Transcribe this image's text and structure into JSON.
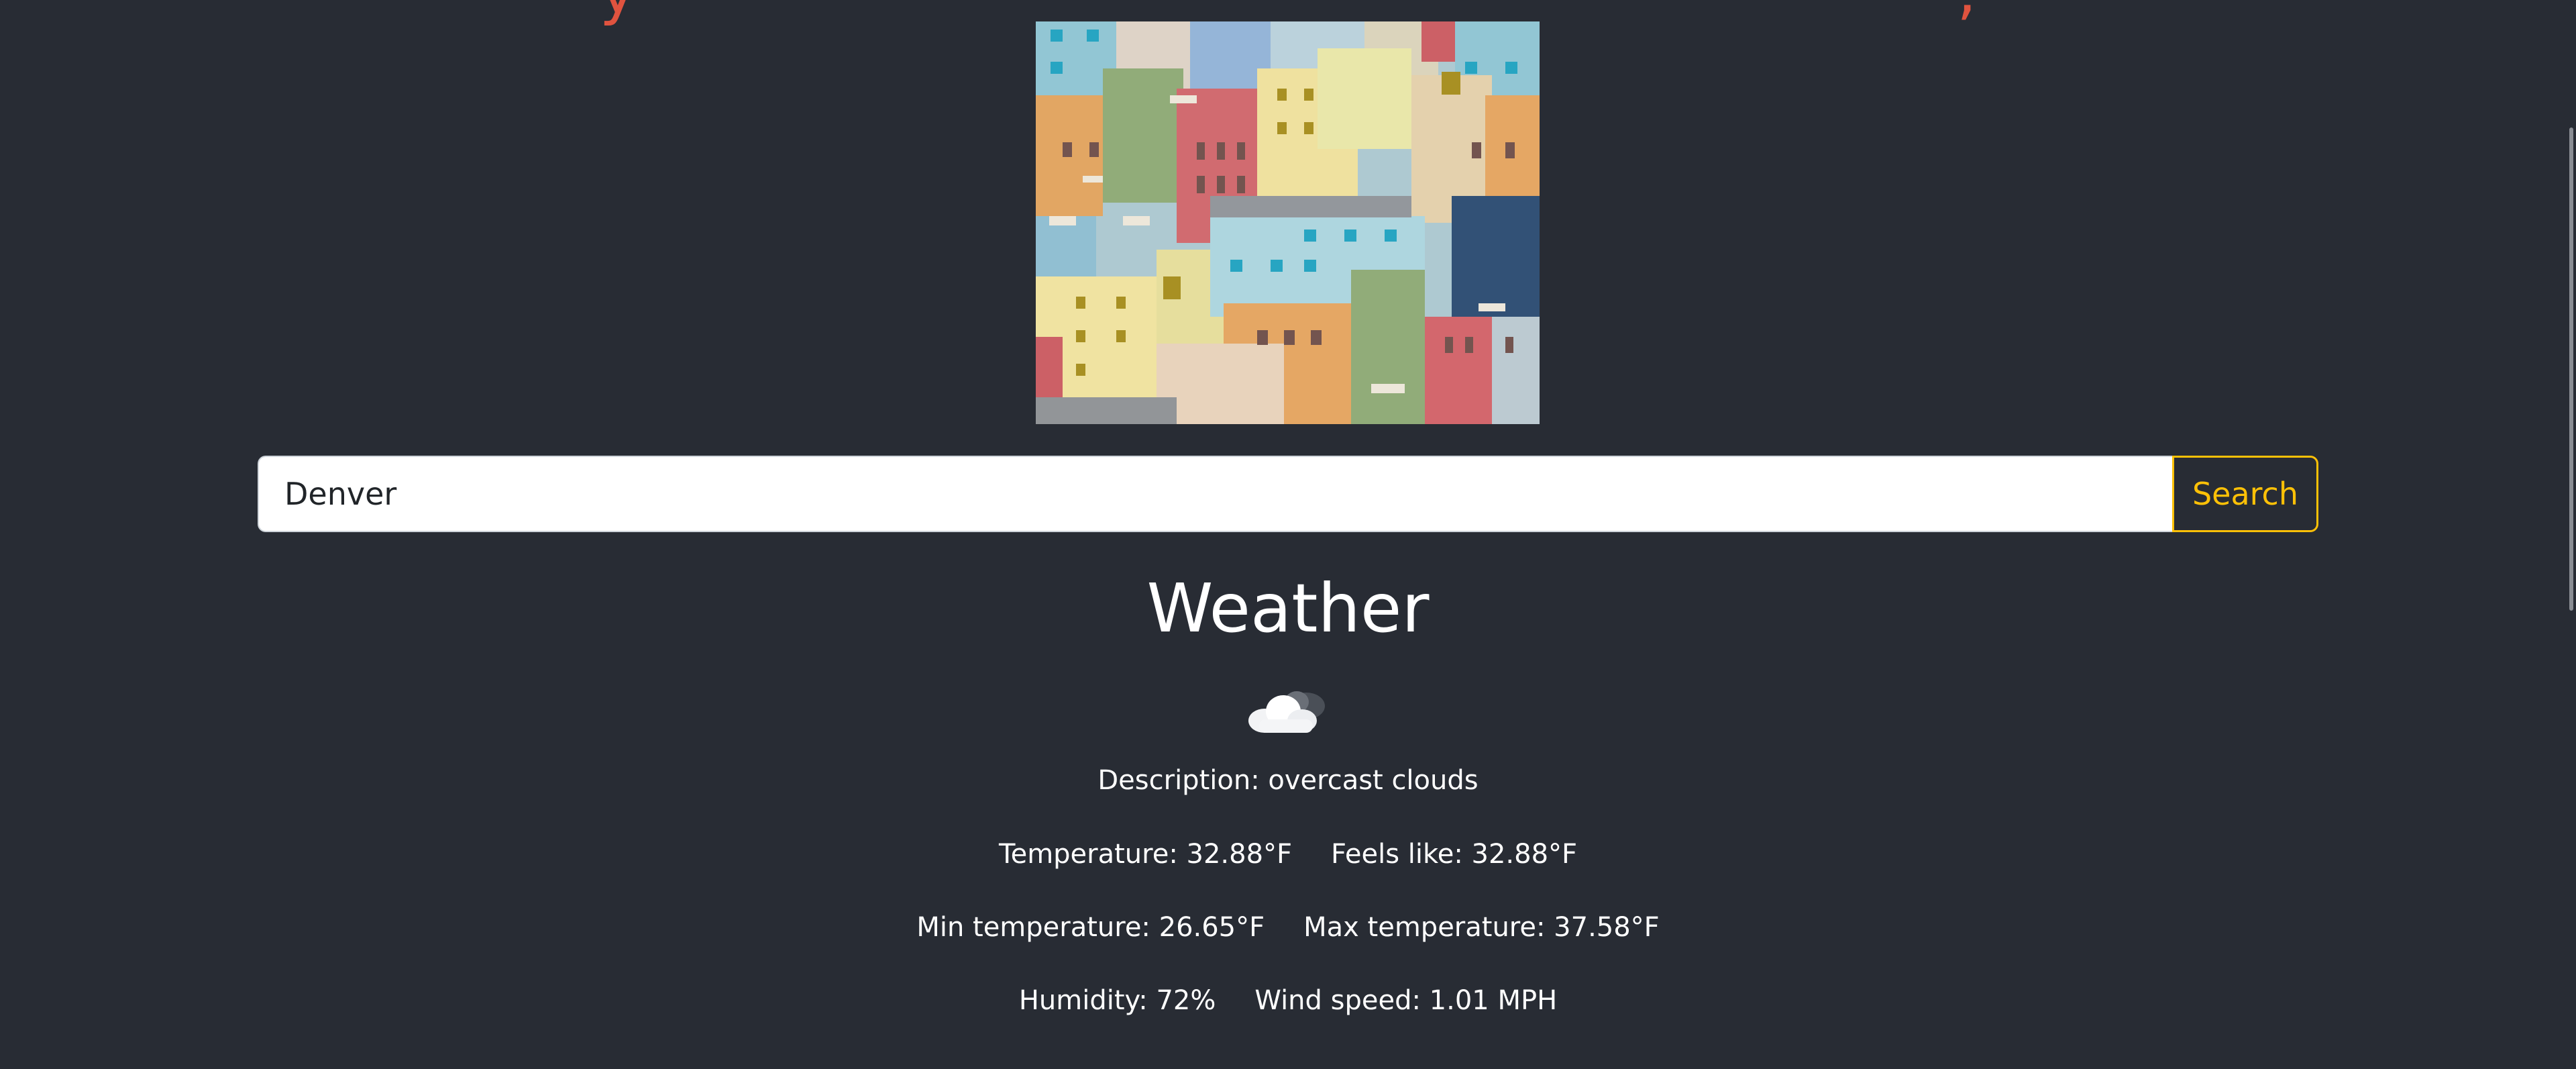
{
  "header": {
    "partial_title": "y — — — — — — — — — — — — — — — — ,"
  },
  "hero_image": {
    "alt": "Colorful city buildings illustration"
  },
  "search": {
    "value": "Denver",
    "button_label": "Search"
  },
  "weather": {
    "title": "Weather",
    "icon": "cloud-icon",
    "description": "Description: overcast clouds",
    "temperature": "Temperature: 32.88°F",
    "feels_like": "Feels like: 32.88°F",
    "min_temperature": "Min temperature: 26.65°F",
    "max_temperature": "Max temperature: 37.58°F",
    "humidity": "Humidity: 72%",
    "wind_speed": "Wind speed: 1.01 MPH"
  },
  "colors": {
    "background": "#282c34",
    "accent": "#ffc107",
    "heading_red": "#e0533f",
    "text": "#ffffff"
  }
}
